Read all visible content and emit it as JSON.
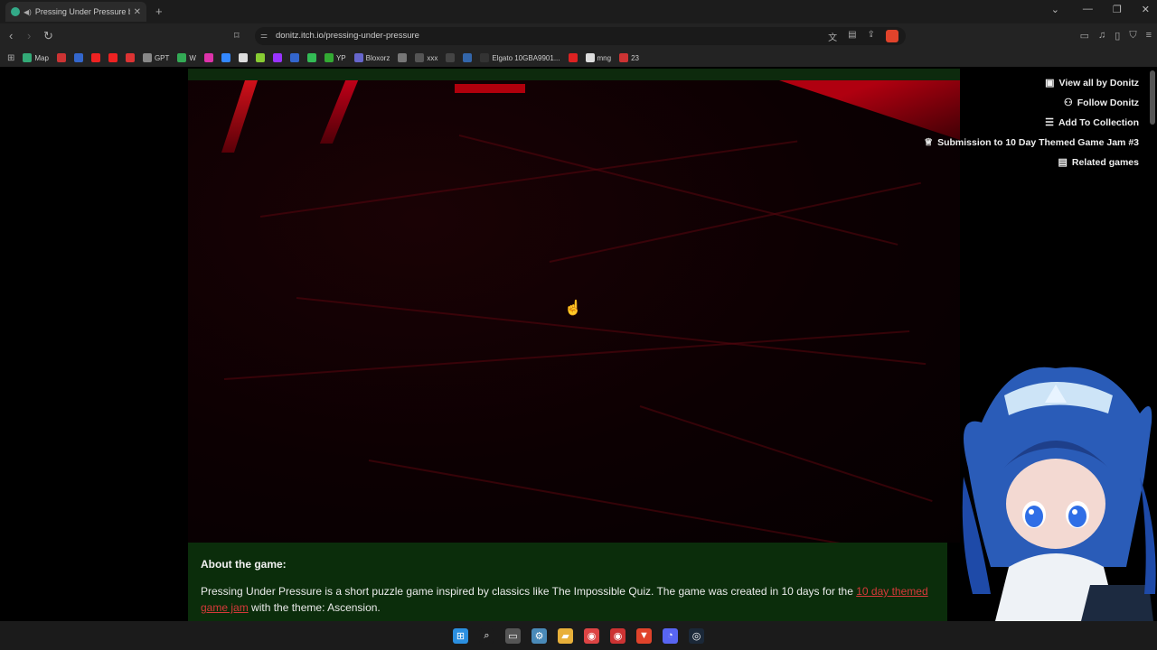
{
  "browser": {
    "tab_title": "Pressing Under Pressure by D",
    "url": "donitz.itch.io/pressing-under-pressure",
    "bookmarks": [
      {
        "label": "Map",
        "color": "#3a7"
      },
      {
        "label": "",
        "color": "#c33"
      },
      {
        "label": "",
        "color": "#36c"
      },
      {
        "label": "",
        "color": "#e22"
      },
      {
        "label": "",
        "color": "#e22"
      },
      {
        "label": "",
        "color": "#d33"
      },
      {
        "label": "GPT",
        "color": "#888"
      },
      {
        "label": "W",
        "color": "#3a5"
      },
      {
        "label": "",
        "color": "#d3a"
      },
      {
        "label": "",
        "color": "#38f"
      },
      {
        "label": "",
        "color": "#ddd"
      },
      {
        "label": "",
        "color": "#8c3"
      },
      {
        "label": "",
        "color": "#93f"
      },
      {
        "label": "",
        "color": "#36c"
      },
      {
        "label": "",
        "color": "#3b5"
      },
      {
        "label": "YP",
        "color": "#3a3"
      },
      {
        "label": "Bloxorz",
        "color": "#66c"
      },
      {
        "label": "",
        "color": "#777"
      },
      {
        "label": "xxx",
        "color": "#555"
      },
      {
        "label": "",
        "color": "#444"
      },
      {
        "label": "",
        "color": "#36a"
      },
      {
        "label": "Elgato 10GBA9901...",
        "color": "#333"
      },
      {
        "label": "",
        "color": "#d22"
      },
      {
        "label": "mng",
        "color": "#ddd"
      },
      {
        "label": "23",
        "color": "#c33"
      }
    ]
  },
  "sidebar": {
    "links": [
      {
        "icon": "view-all-icon",
        "glyph": "▣",
        "label": "View all by Donitz"
      },
      {
        "icon": "follow-icon",
        "glyph": "⚇",
        "label": "Follow Donitz"
      },
      {
        "icon": "collection-icon",
        "glyph": "☰",
        "label": "Add To Collection"
      },
      {
        "icon": "trophy-icon",
        "glyph": "♕",
        "label": "Submission to 10 Day Themed Game Jam #3"
      },
      {
        "icon": "map-icon",
        "glyph": "▤",
        "label": "Related games"
      }
    ]
  },
  "about": {
    "heading": "About the game:",
    "text_before": "Pressing Under Pressure is a short puzzle game inspired by classics like The Impossible Quiz. The game was created in 10 days for the ",
    "link": "10 day themed game jam",
    "text_after": " with the theme: Ascension."
  },
  "taskbar": {
    "apps": [
      {
        "name": "start-icon",
        "color": "#2b8fe0",
        "glyph": "⊞"
      },
      {
        "name": "search-icon",
        "color": "#1b1b1b",
        "glyph": "⌕"
      },
      {
        "name": "task-view-icon",
        "color": "#555",
        "glyph": "▭"
      },
      {
        "name": "settings-icon",
        "color": "#4a8ab8",
        "glyph": "⚙"
      },
      {
        "name": "folder-icon",
        "color": "#e8b03a",
        "glyph": "▰"
      },
      {
        "name": "chrome-icon",
        "color": "#d44",
        "glyph": "◉"
      },
      {
        "name": "chrome-alt-icon",
        "color": "#c33",
        "glyph": "◉"
      },
      {
        "name": "brave-icon",
        "color": "#e0432b",
        "glyph": "▼"
      },
      {
        "name": "discord-icon",
        "color": "#5865f2",
        "glyph": "◔"
      },
      {
        "name": "steam-icon",
        "color": "#1b2838",
        "glyph": "◎"
      }
    ]
  }
}
